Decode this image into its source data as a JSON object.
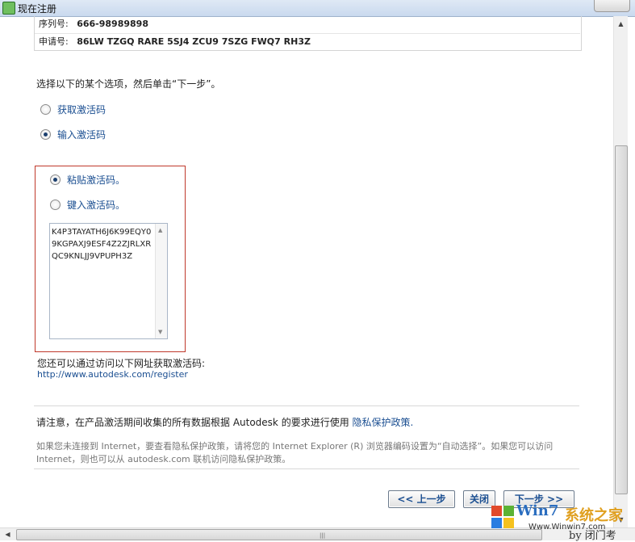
{
  "window": {
    "title": "现在注册",
    "close_icon": "close-icon"
  },
  "info": {
    "serial_label": "序列号:",
    "serial_value": "666-98989898",
    "request_label": "申请号:",
    "request_value": "86LW TZGQ RARE 5SJ4 ZCU9 7SZG FWQ7 RH3Z"
  },
  "instruction": "选择以下的某个选项，然后单击“下一步”。",
  "options": {
    "get_code": {
      "label": "获取激活码",
      "selected": false
    },
    "enter_code": {
      "label": "输入激活码",
      "selected": true
    }
  },
  "sub_options": {
    "paste": {
      "label": "粘贴激活码。",
      "selected": true
    },
    "type": {
      "label": "键入激活码。",
      "selected": false
    }
  },
  "activation_code": "K4P3TAYATH6J6K99EQY09KGPAXJ9ESF4Z2ZJRLXRQC9KNLJJ9VPUPH3Z",
  "alt_text": "您还可以通过访问以下网址获取激活码:",
  "alt_url": "http://www.autodesk.com/register",
  "notice": {
    "text": "请注意，在产品激活期间收集的所有数据根据 Autodesk 的要求进行使用",
    "link": "隐私保护政策."
  },
  "faded_text": "如果您未连接到 Internet，要查看隐私保护政策，请将您的 Internet Explorer (R) 浏览器编码设置为“自动选择”。如果您可以访问 Internet，则也可以从 autodesk.com 联机访问隐私保护政策。",
  "buttons": {
    "back": "<< 上一步",
    "close": "关闭",
    "next": "下一步 >>"
  },
  "watermark": {
    "brand": "Win7",
    "brand_zh": "系统之家",
    "site": "Www.Winwin7.com",
    "by": "by 闭门考"
  },
  "colors": {
    "link": "#1a4e91",
    "red_box": "#c0392b",
    "watermark_blue": "#2a6dbf",
    "watermark_gold": "#e0a020"
  }
}
